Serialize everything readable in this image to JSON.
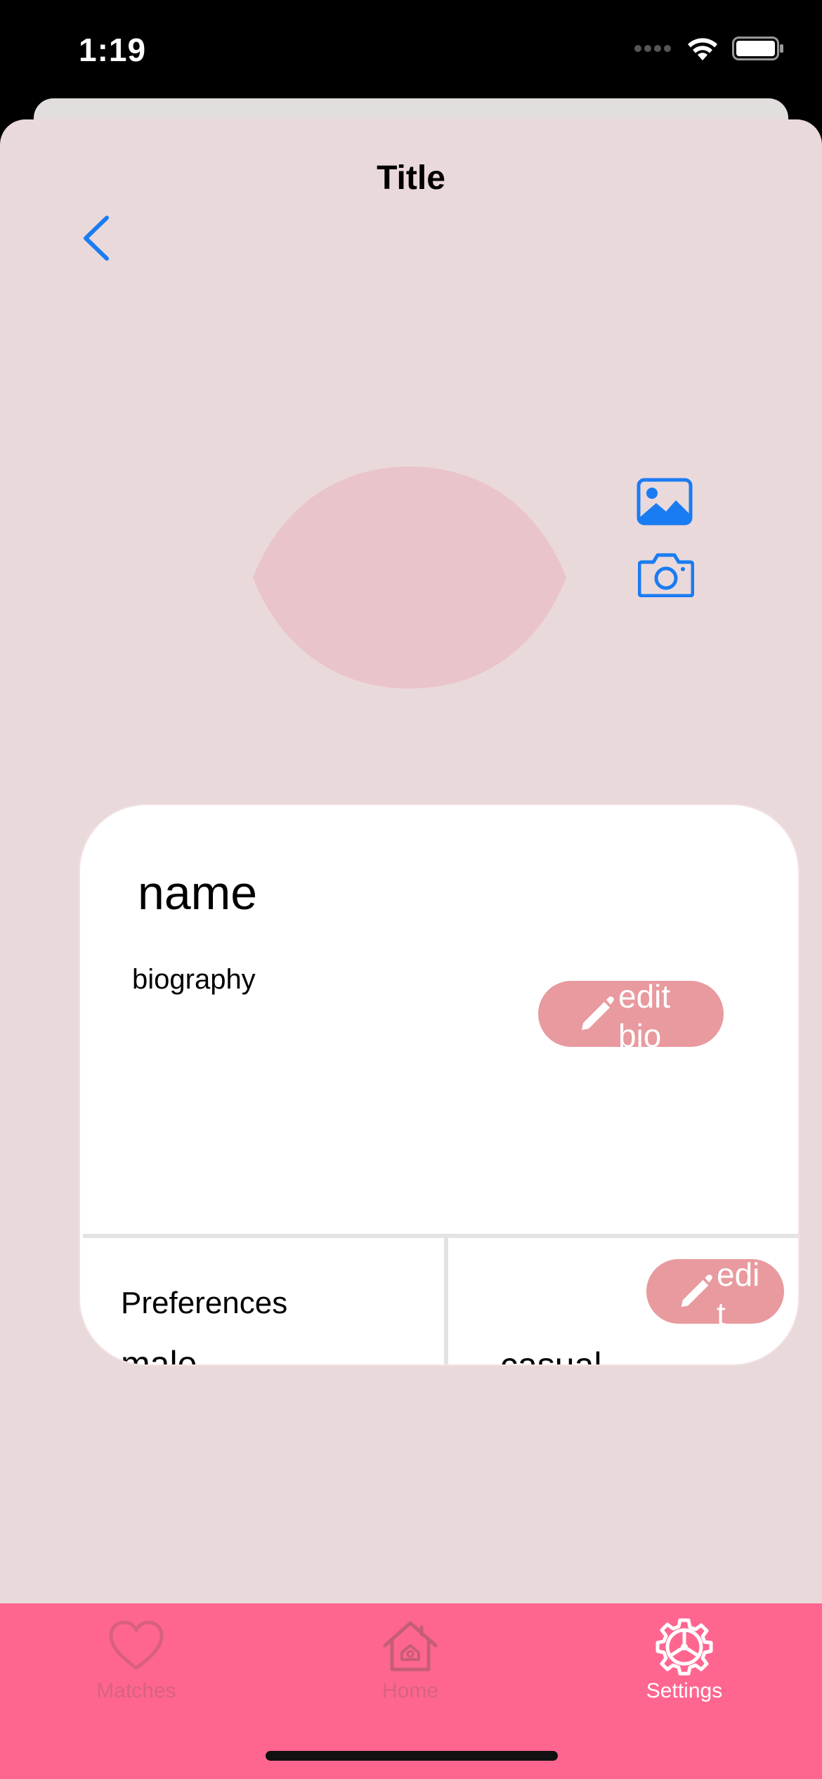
{
  "status_bar": {
    "time": "1:19"
  },
  "nav": {
    "title": "Title",
    "back_icon": "chevron-left-icon"
  },
  "photo_actions": {
    "gallery_icon": "photo-icon",
    "camera_icon": "camera-icon"
  },
  "profile_card": {
    "name": "name",
    "biography": "biography",
    "edit_bio_label": "edit bio",
    "preferences_label": "Preferences",
    "preferences_value": "male",
    "looking_for_value": "casual",
    "edit_preferences_label": "edit"
  },
  "tab_bar": {
    "tabs": [
      {
        "label": "Matches",
        "icon": "heart-icon",
        "selected": false
      },
      {
        "label": "Home",
        "icon": "house-icon",
        "selected": false
      },
      {
        "label": "Settings",
        "icon": "gear-icon",
        "selected": true
      }
    ]
  },
  "colors": {
    "sheet_background": "#ead9db",
    "accent_blue": "#1a7cf2",
    "tab_bar": "#ff668f",
    "edit_button": "#e89a9f",
    "avatar_placeholder": "#eac4cb"
  }
}
